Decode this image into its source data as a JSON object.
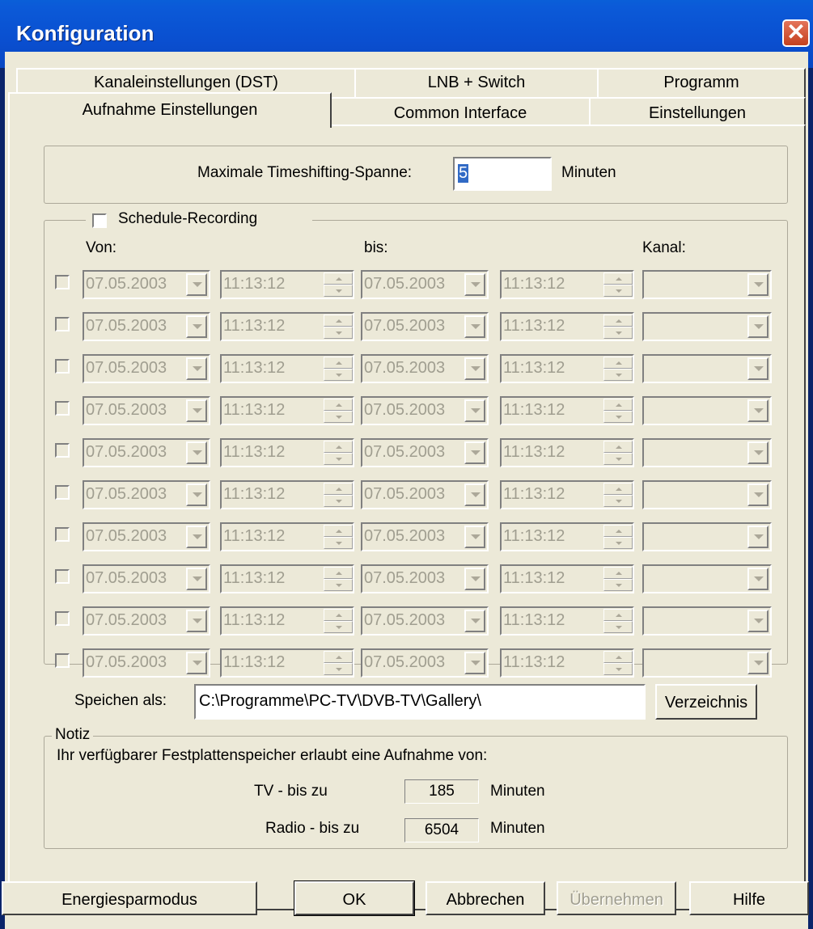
{
  "window": {
    "title": "Konfiguration",
    "close_glyph": "✕"
  },
  "tabs": {
    "row_back": [
      "Kanaleinstellungen  (DST)",
      "LNB + Switch",
      "Programm"
    ],
    "row_front": [
      "Aufnahme Einstellungen",
      "Common Interface",
      "Einstellungen"
    ],
    "active": "Aufnahme Einstellungen"
  },
  "timeshift": {
    "label": "Maximale Timeshifting-Spanne:",
    "value": "5",
    "unit": "Minuten"
  },
  "schedule": {
    "title": "Schedule-Recording",
    "col_from": "Von:",
    "col_to": "bis:",
    "col_channel": "Kanal:",
    "rows": [
      {
        "from_date": "07.05.2003",
        "from_time": "11:13:12",
        "to_date": "07.05.2003",
        "to_time": "11:13:12",
        "channel": ""
      },
      {
        "from_date": "07.05.2003",
        "from_time": "11:13:12",
        "to_date": "07.05.2003",
        "to_time": "11:13:12",
        "channel": ""
      },
      {
        "from_date": "07.05.2003",
        "from_time": "11:13:12",
        "to_date": "07.05.2003",
        "to_time": "11:13:12",
        "channel": ""
      },
      {
        "from_date": "07.05.2003",
        "from_time": "11:13:12",
        "to_date": "07.05.2003",
        "to_time": "11:13:12",
        "channel": ""
      },
      {
        "from_date": "07.05.2003",
        "from_time": "11:13:12",
        "to_date": "07.05.2003",
        "to_time": "11:13:12",
        "channel": ""
      },
      {
        "from_date": "07.05.2003",
        "from_time": "11:13:12",
        "to_date": "07.05.2003",
        "to_time": "11:13:12",
        "channel": ""
      },
      {
        "from_date": "07.05.2003",
        "from_time": "11:13:12",
        "to_date": "07.05.2003",
        "to_time": "11:13:12",
        "channel": ""
      },
      {
        "from_date": "07.05.2003",
        "from_time": "11:13:12",
        "to_date": "07.05.2003",
        "to_time": "11:13:12",
        "channel": ""
      },
      {
        "from_date": "07.05.2003",
        "from_time": "11:13:12",
        "to_date": "07.05.2003",
        "to_time": "11:13:12",
        "channel": ""
      },
      {
        "from_date": "07.05.2003",
        "from_time": "11:13:12",
        "to_date": "07.05.2003",
        "to_time": "11:13:12",
        "channel": ""
      }
    ]
  },
  "save": {
    "label": "Speichen als:",
    "path": "C:\\Programme\\PC-TV\\DVB-TV\\Gallery\\",
    "browse_label": "Verzeichnis"
  },
  "notiz": {
    "title": "Notiz",
    "text": "Ihr verfügbarer Festplattenspeicher erlaubt eine Aufnahme von:",
    "tv_label": "TV  -   bis zu",
    "tv_value": "185",
    "radio_label": "Radio - bis zu",
    "radio_value": "6504",
    "unit": "Minuten"
  },
  "buttons": {
    "energy": "Energiesparmodus",
    "ok": "OK",
    "cancel": "Abbrechen",
    "apply": "Übernehmen",
    "help": "Hilfe"
  }
}
